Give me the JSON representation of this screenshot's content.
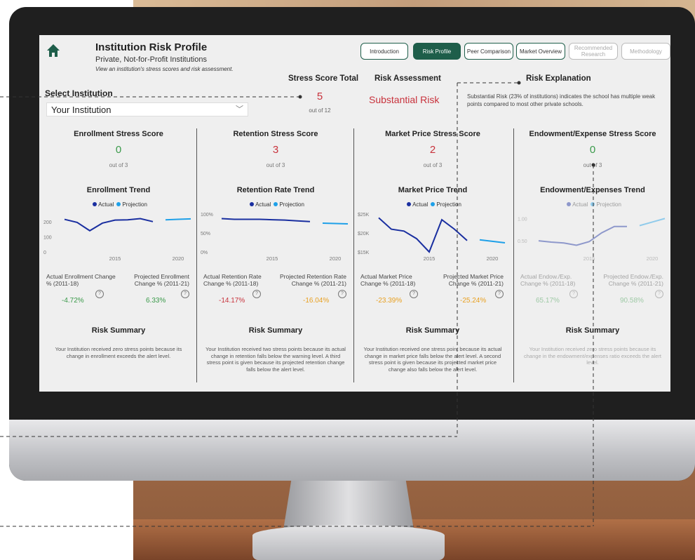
{
  "header": {
    "title": "Institution Risk Profile",
    "subtitle": "Private, Not-for-Profit Institutions",
    "description": "View an institution's stress scores and risk assessment."
  },
  "tabs": [
    {
      "label": "Introduction"
    },
    {
      "label": "Risk Profile"
    },
    {
      "label": "Peer Comparison"
    },
    {
      "label": "Market Overview"
    },
    {
      "label": "Recommended Research"
    },
    {
      "label": "Methodology"
    }
  ],
  "select": {
    "label": "Select Institution",
    "value": "Your Institution"
  },
  "total": {
    "label": "Stress Score Total",
    "value": "5",
    "out_of": "out of 12"
  },
  "assessment": {
    "label": "Risk Assessment",
    "value": "Substantial Risk"
  },
  "explanation": {
    "label": "Risk Explanation",
    "text": "Substantial Risk (23% of institutions) indicates the school has multiple weak points compared to most other private schools."
  },
  "legend": {
    "actual": "Actual",
    "projection": "Projection"
  },
  "columns": [
    {
      "score_title": "Enrollment Stress Score",
      "score": "0",
      "out_of": "out of 3",
      "trend_title": "Enrollment Trend",
      "y_ticks": [
        "200",
        "100",
        "0"
      ],
      "x_ticks": [
        "2015",
        "2020"
      ],
      "actual_label": "Actual Enrollment Change % (2011-18)",
      "actual_value": "-4.72%",
      "proj_label": "Projected Enrollment Change % (2011-21)",
      "proj_value": "6.33%",
      "summary_title": "Risk Summary",
      "summary": "Your Institution received zero stress points because its change in enrollment exceeds the alert level."
    },
    {
      "score_title": "Retention Stress Score",
      "score": "3",
      "out_of": "out of 3",
      "trend_title": "Retention Rate Trend",
      "y_ticks": [
        "100%",
        "50%",
        "0%"
      ],
      "x_ticks": [
        "2015",
        "2020"
      ],
      "actual_label": "Actual Retention Rate Change % (2011-18)",
      "actual_value": "-14.17%",
      "proj_label": "Projected Retention Rate Change % (2011-21)",
      "proj_value": "-16.04%",
      "summary_title": "Risk Summary",
      "summary": "Your Institution received two stress points because its actual change in retention falls below the warning level. A third stress point is given because its projected retention change falls below the alert level."
    },
    {
      "score_title": "Market Price Stress Score",
      "score": "2",
      "out_of": "out of 3",
      "trend_title": "Market Price Trend",
      "y_ticks": [
        "$25K",
        "$20K",
        "$15K"
      ],
      "x_ticks": [
        "2015",
        "2020"
      ],
      "actual_label": "Actual Market Price Change % (2011-18)",
      "actual_value": "-23.39%",
      "proj_label": "Projected Market Price Change % (2011-21)",
      "proj_value": "-25.24%",
      "summary_title": "Risk Summary",
      "summary": "Your Institution received one stress point because its actual change in market price falls below the alert level. A second stress point is given because its projected market price change also falls below the alert level."
    },
    {
      "score_title": "Endowment/Expense Stress Score",
      "score": "0",
      "out_of": "out of 3",
      "trend_title": "Endowment/Expenses Trend",
      "y_ticks": [
        "1.00",
        "0.50"
      ],
      "x_ticks": [
        "2015",
        "2020"
      ],
      "actual_label": "Actual Endow./Exp. Change % (2011-18)",
      "actual_value": "65.17%",
      "proj_label": "Projected Endow./Exp. Change % (2011-21)",
      "proj_value": "90.58%",
      "summary_title": "Risk Summary",
      "summary": "Your Institution received zero stress points because its change in the endowment/expenses ratio exceeds the alert level."
    }
  ],
  "colors": {
    "brand": "#1e5e4a",
    "good": "#3a9a4a",
    "bad": "#c8323c",
    "warn": "#e8a020",
    "actual": "#1a2fa0",
    "projection": "#1ea0e8"
  },
  "chart_data": [
    {
      "type": "line",
      "title": "Enrollment Trend",
      "ylim": [
        0,
        250
      ],
      "series": [
        {
          "name": "Actual",
          "x": [
            2011,
            2012,
            2013,
            2014,
            2015,
            2016,
            2017,
            2018
          ],
          "values": [
            215,
            195,
            140,
            190,
            210,
            212,
            220,
            200
          ]
        },
        {
          "name": "Projection",
          "x": [
            2019,
            2020,
            2021
          ],
          "values": [
            212,
            215,
            218
          ]
        }
      ]
    },
    {
      "type": "line",
      "title": "Retention Rate Trend",
      "ylim": [
        0,
        100
      ],
      "series": [
        {
          "name": "Actual",
          "x": [
            2011,
            2012,
            2013,
            2014,
            2015,
            2016,
            2017,
            2018
          ],
          "values": [
            88,
            86,
            86,
            86,
            85,
            84,
            82,
            80
          ]
        },
        {
          "name": "Projection",
          "x": [
            2019,
            2020,
            2021
          ],
          "values": [
            76,
            75,
            74
          ]
        }
      ]
    },
    {
      "type": "line",
      "title": "Market Price Trend",
      "ylim": [
        15000,
        25000
      ],
      "series": [
        {
          "name": "Actual",
          "x": [
            2011,
            2012,
            2013,
            2014,
            2015,
            2016,
            2017,
            2018
          ],
          "values": [
            24000,
            21000,
            20500,
            18500,
            15000,
            23500,
            21000,
            18000
          ]
        },
        {
          "name": "Projection",
          "x": [
            2019,
            2020,
            2021
          ],
          "values": [
            18200,
            17800,
            17400
          ]
        }
      ]
    },
    {
      "type": "line",
      "title": "Endowment/Expenses Trend",
      "ylim": [
        0.25,
        1.1
      ],
      "series": [
        {
          "name": "Actual",
          "x": [
            2011,
            2012,
            2013,
            2014,
            2015,
            2016,
            2017,
            2018
          ],
          "values": [
            0.5,
            0.47,
            0.45,
            0.4,
            0.48,
            0.68,
            0.82,
            0.82
          ]
        },
        {
          "name": "Projection",
          "x": [
            2019,
            2020,
            2021
          ],
          "values": [
            0.84,
            0.92,
            1.0
          ]
        }
      ]
    }
  ]
}
